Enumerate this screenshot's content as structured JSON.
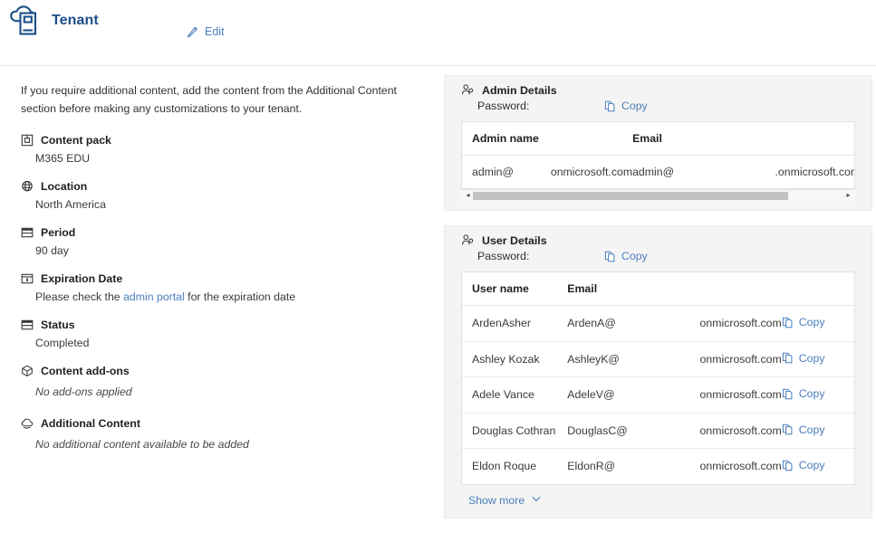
{
  "header": {
    "icon": "cloud-book-icon",
    "title": "Tenant",
    "edit": {
      "icon": "pencil-icon",
      "label": "Edit"
    }
  },
  "left": {
    "intro": "If you require additional content, add the content from the Additional Content section before making any customizations to your tenant.",
    "fields": [
      {
        "icon": "package-box-icon",
        "label": "Content pack",
        "value": "M365 EDU"
      },
      {
        "icon": "globe-icon",
        "label": "Location",
        "value": "North America"
      },
      {
        "icon": "calendar-icon",
        "label": "Period",
        "value": "90 day"
      },
      {
        "icon": "calendar-event-icon",
        "label": "Expiration Date",
        "value_before": "Please check the ",
        "link": "admin portal",
        "value_after": " for the expiration date"
      },
      {
        "icon": "calendar-icon",
        "label": "Status",
        "value": "Completed"
      },
      {
        "icon": "cube-add-icon",
        "label": "Content add-ons",
        "value": "No add-ons applied"
      },
      {
        "icon": "cloud-content-icon",
        "label": "Additional Content",
        "value": "No additional content available to be added"
      }
    ]
  },
  "admin_panel": {
    "icon": "people-icon",
    "title": "Admin Details",
    "password_label": "Password:",
    "copy": {
      "icon": "copy-icon",
      "label": "Copy"
    },
    "columns": [
      "Admin name",
      "Email"
    ],
    "rows": [
      {
        "name_prefix": "admin@",
        "name_suffix": "onmicrosoft.com",
        "email_prefix": "admin@",
        "email_suffix": ".onmicrosoft.cor"
      }
    ],
    "scrollbar": {
      "left_arrow": "◂",
      "right_arrow": "▸",
      "thumb_width_pct": 85
    }
  },
  "user_panel": {
    "icon": "people-icon",
    "title": "User Details",
    "password_label": "Password:",
    "copy": {
      "icon": "copy-icon",
      "label": "Copy"
    },
    "columns": [
      "User name",
      "Email",
      ""
    ],
    "rows": [
      {
        "name": "ArdenAsher",
        "email_prefix": "ArdenA@",
        "email_suffix": "onmicrosoft.com",
        "copy": "Copy"
      },
      {
        "name": "Ashley Kozak",
        "email_prefix": "AshleyK@",
        "email_suffix": "onmicrosoft.com",
        "copy": "Copy"
      },
      {
        "name": "Adele Vance",
        "email_prefix": "AdeleV@",
        "email_suffix": "onmicrosoft.com",
        "copy": "Copy"
      },
      {
        "name": "Douglas Cothran",
        "email_prefix": "DouglasC@",
        "email_suffix": "onmicrosoft.com",
        "copy": "Copy"
      },
      {
        "name": "Eldon Roque",
        "email_prefix": "EldonR@",
        "email_suffix": "onmicrosoft.com",
        "copy": "Copy"
      }
    ],
    "show_more": {
      "label": "Show more",
      "icon": "chevron-down-icon"
    }
  },
  "colors": {
    "title_blue": "#1b4f8a",
    "link_blue": "#4a7ebb",
    "panel_bg": "#f4f4f4",
    "text": "#323130"
  }
}
